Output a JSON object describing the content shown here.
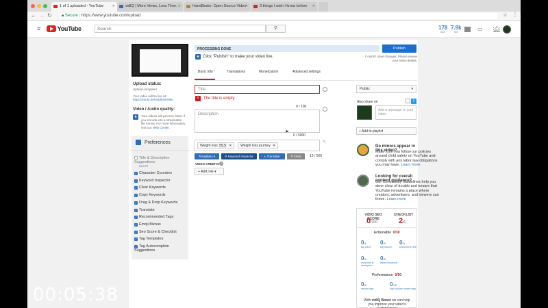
{
  "browser": {
    "tabs": [
      {
        "label": "1 of 1 uploaded - YouTube",
        "active": true,
        "icon_color": "#e02020"
      },
      {
        "label": "vidIQ | More Views, Less Time.",
        "active": false,
        "icon_color": "#2f6db5"
      },
      {
        "label": "HandBrake: Open Source Video",
        "active": false,
        "icon_color": "#c08030"
      },
      {
        "label": "3 things I wish I knew before",
        "active": false,
        "icon_color": "#e02020"
      }
    ],
    "secure_label": "Secure",
    "url": "https://www.youtube.com/upload"
  },
  "header": {
    "logo_text": "YouTube",
    "search_placeholder": "Search",
    "stats": [
      {
        "value": "178",
        "label": "60m"
      },
      {
        "value": "7.9k",
        "label": "48h"
      }
    ]
  },
  "left": {
    "upload_status_title": "Upload status:",
    "upload_status": "Upload complete!",
    "live_text": "Your video will be live at:",
    "video_link": "https://youtu.be/ot4d04mV8w",
    "quality_title": "Video / Audio quality:",
    "quality_text": "Your videos will process faster if you encode into a streamable file format. For more information, visit our",
    "help_center": "Help Center.",
    "preferences_title": "Preferences",
    "pref_first": "Title & Description Suggestions",
    "pref_boost": "BOOST",
    "prefs": [
      "Character Counters",
      "Keyword Inspector",
      "Clear Keywords",
      "Copy Keywords",
      "Drag & Drop Keywords",
      "Translate",
      "Recommended Tags",
      "Emoji Menus",
      "Seo Score & Checklist",
      "Tag Templates",
      "Tag Autocomplete Suggestions"
    ]
  },
  "main": {
    "processing": "PROCESSING DONE",
    "publish_hint": "Click \"Publish\" to make your video live.",
    "publish_label": "Publish",
    "save_note": "Couldn't save changes. Please review your video details.",
    "tabs": [
      "Basic info",
      "Translations",
      "Monetization",
      "Advanced settings"
    ],
    "title_placeholder": "Title",
    "title_error": "The title is empty.",
    "title_count": "0 / 100",
    "desc_placeholder": "Description",
    "desc_count": "0 / 5000",
    "tags": [
      {
        "label": "Weight loss",
        "score": "55.5"
      },
      {
        "label": "Weight loss journey",
        "score": ""
      }
    ],
    "tag_count": "13 / 500",
    "buttons": {
      "templates": "Templates",
      "keyword_inspector": "Keyword Inspector",
      "translate": "Translate",
      "clear": "Clear"
    },
    "video_credits": "VIDEO CREDITS",
    "add_role": "Add role"
  },
  "right": {
    "privacy": "Public",
    "also_share": "Also share on",
    "message_placeholder": "Add a message to your video",
    "add_playlist": "+ Add to playlist",
    "minors_title": "Do minors appear in this video?",
    "minors_text": "Make sure you follow our policies around child safety on YouTube and comply with any labor law obligations you may have.",
    "minors_link": "Learn more",
    "guidance_title": "Looking for overall content guidance?",
    "guidance_text": "Our Community Guidelines help you steer clear of trouble and ensure that YouTube remains a place where creators, advertisers, and viewers can thrive.",
    "guidance_link": "Learn more",
    "seo": {
      "score_label": "VIDIQ SEO SCORE",
      "score": "0",
      "score_den": "/100",
      "checklist_label": "CHECKLIST",
      "checklist": "2",
      "checklist_den": "/9",
      "actionable_label": "Actionable",
      "actionable": "0/30",
      "actionable_items": [
        {
          "value": "0",
          "den": "/5",
          "label": "tag count"
        },
        {
          "value": "0",
          "den": "/5",
          "label": "tag volume"
        },
        {
          "value": "0",
          "den": "/5",
          "label": "keywords in title"
        },
        {
          "value": "0",
          "den": "/5",
          "label": "keywords in description"
        },
        {
          "value": "0",
          "den": "/5",
          "label": "tripled keywords"
        }
      ],
      "performance_label": "Performance",
      "performance": "0/50",
      "performance_items": [
        {
          "value": "0",
          "den": "/5",
          "label": "ranked tags"
        },
        {
          "value": "0",
          "den": "/45",
          "label": "high volume ranked tags"
        }
      ],
      "boost_text_pre": "With",
      "boost_brand": "vidIQ Boost",
      "boost_text_post": "we can help you improve your video's performance!"
    }
  },
  "overlay_timer": "00:05:38"
}
